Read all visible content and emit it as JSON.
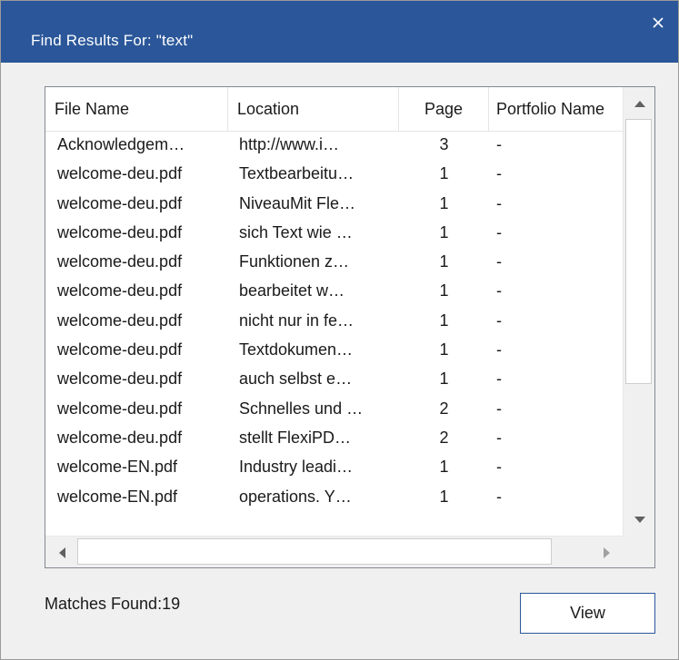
{
  "dialog": {
    "title": "Find Results For: \"text\"",
    "accent_color": "#2b579a",
    "close_icon": "close-icon"
  },
  "table": {
    "columns": [
      "File Name",
      "Location",
      "Page",
      "Portfolio Name"
    ],
    "rows": [
      {
        "file": "Acknowledgem…",
        "location": "http://www.i…",
        "page": "3",
        "portfolio": "-"
      },
      {
        "file": "welcome-deu.pdf",
        "location": "Textbearbeitu…",
        "page": "1",
        "portfolio": "-"
      },
      {
        "file": "welcome-deu.pdf",
        "location": "NiveauMit Fle…",
        "page": "1",
        "portfolio": "-"
      },
      {
        "file": "welcome-deu.pdf",
        "location": "sich Text wie …",
        "page": "1",
        "portfolio": "-"
      },
      {
        "file": "welcome-deu.pdf",
        "location": "Funktionen z…",
        "page": "1",
        "portfolio": "-"
      },
      {
        "file": "welcome-deu.pdf",
        "location": "bearbeitet w…",
        "page": "1",
        "portfolio": "-"
      },
      {
        "file": "welcome-deu.pdf",
        "location": "nicht nur in fe…",
        "page": "1",
        "portfolio": "-"
      },
      {
        "file": "welcome-deu.pdf",
        "location": "Textdokumen…",
        "page": "1",
        "portfolio": "-"
      },
      {
        "file": "welcome-deu.pdf",
        "location": "auch selbst e…",
        "page": "1",
        "portfolio": "-"
      },
      {
        "file": "welcome-deu.pdf",
        "location": "Schnelles und …",
        "page": "2",
        "portfolio": "-"
      },
      {
        "file": "welcome-deu.pdf",
        "location": "stellt FlexiPD…",
        "page": "2",
        "portfolio": "-"
      },
      {
        "file": "welcome-EN.pdf",
        "location": "Industry leadi…",
        "page": "1",
        "portfolio": "-"
      },
      {
        "file": "welcome-EN.pdf",
        "location": "operations. Y…",
        "page": "1",
        "portfolio": "-"
      }
    ]
  },
  "footer": {
    "matches_label": "Matches Found:19",
    "view_button": "View"
  }
}
